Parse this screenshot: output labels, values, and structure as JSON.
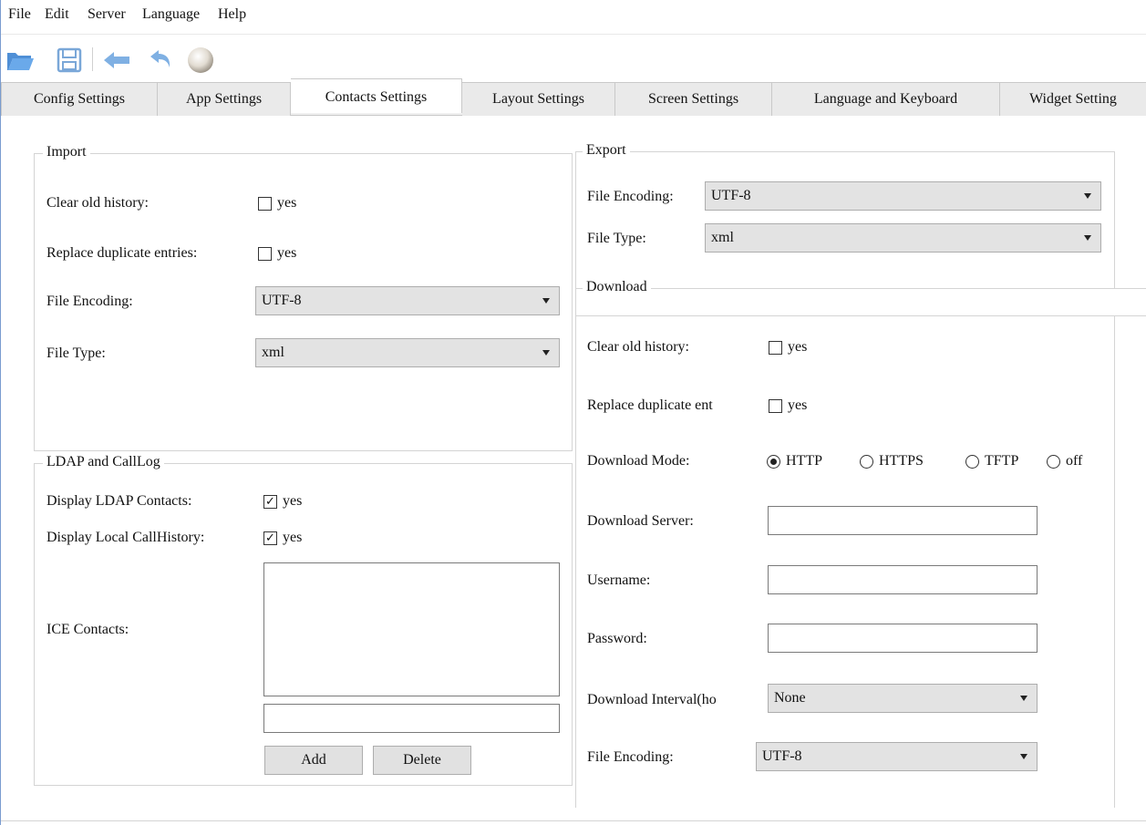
{
  "menu": [
    "File",
    "Edit",
    "Server",
    "Language",
    "Help"
  ],
  "toolbar": {
    "icons": [
      "folder-open-icon",
      "save-icon",
      "back-arrow-icon",
      "undo-icon",
      "status-ball-icon"
    ]
  },
  "tabs": [
    {
      "label": "Config Settings"
    },
    {
      "label": "App Settings"
    },
    {
      "label": "Contacts Settings",
      "active": true
    },
    {
      "label": "Layout Settings"
    },
    {
      "label": "Screen Settings"
    },
    {
      "label": "Language and Keyboard"
    },
    {
      "label": "Widget Setting"
    }
  ],
  "import": {
    "title": "Import",
    "clear_history_label": "Clear old history:",
    "clear_history_value": "yes",
    "replace_dup_label": "Replace duplicate entries:",
    "replace_dup_value": "yes",
    "encoding_label": "File Encoding:",
    "encoding_value": "UTF-8",
    "type_label": "File Type:",
    "type_value": "xml"
  },
  "ldap": {
    "title": "LDAP and CallLog",
    "display_ldap_label": "Display LDAP Contacts:",
    "display_ldap_value": "yes",
    "display_local_label": "Display Local CallHistory:",
    "display_local_value": "yes",
    "ice_label": "ICE Contacts:",
    "ice_input_value": "",
    "add_label": "Add",
    "delete_label": "Delete"
  },
  "export": {
    "title": "Export",
    "encoding_label": "File Encoding:",
    "encoding_value": "UTF-8",
    "type_label": "File Type:",
    "type_value": "xml"
  },
  "download": {
    "title": "Download",
    "clear_history_label": "Clear old history:",
    "clear_history_value": "yes",
    "replace_dup_label": "Replace duplicate ent",
    "replace_dup_value": "yes",
    "mode_label": "Download Mode:",
    "modes": [
      "HTTP",
      "HTTPS",
      "TFTP",
      "off"
    ],
    "mode_selected": "HTTP",
    "server_label": "Download Server:",
    "server_value": "",
    "username_label": "Username:",
    "username_value": "",
    "password_label": "Password:",
    "password_value": "",
    "interval_label": "Download Interval(ho",
    "interval_value": "None",
    "encoding_label": "File Encoding:",
    "encoding_value": "UTF-8"
  }
}
